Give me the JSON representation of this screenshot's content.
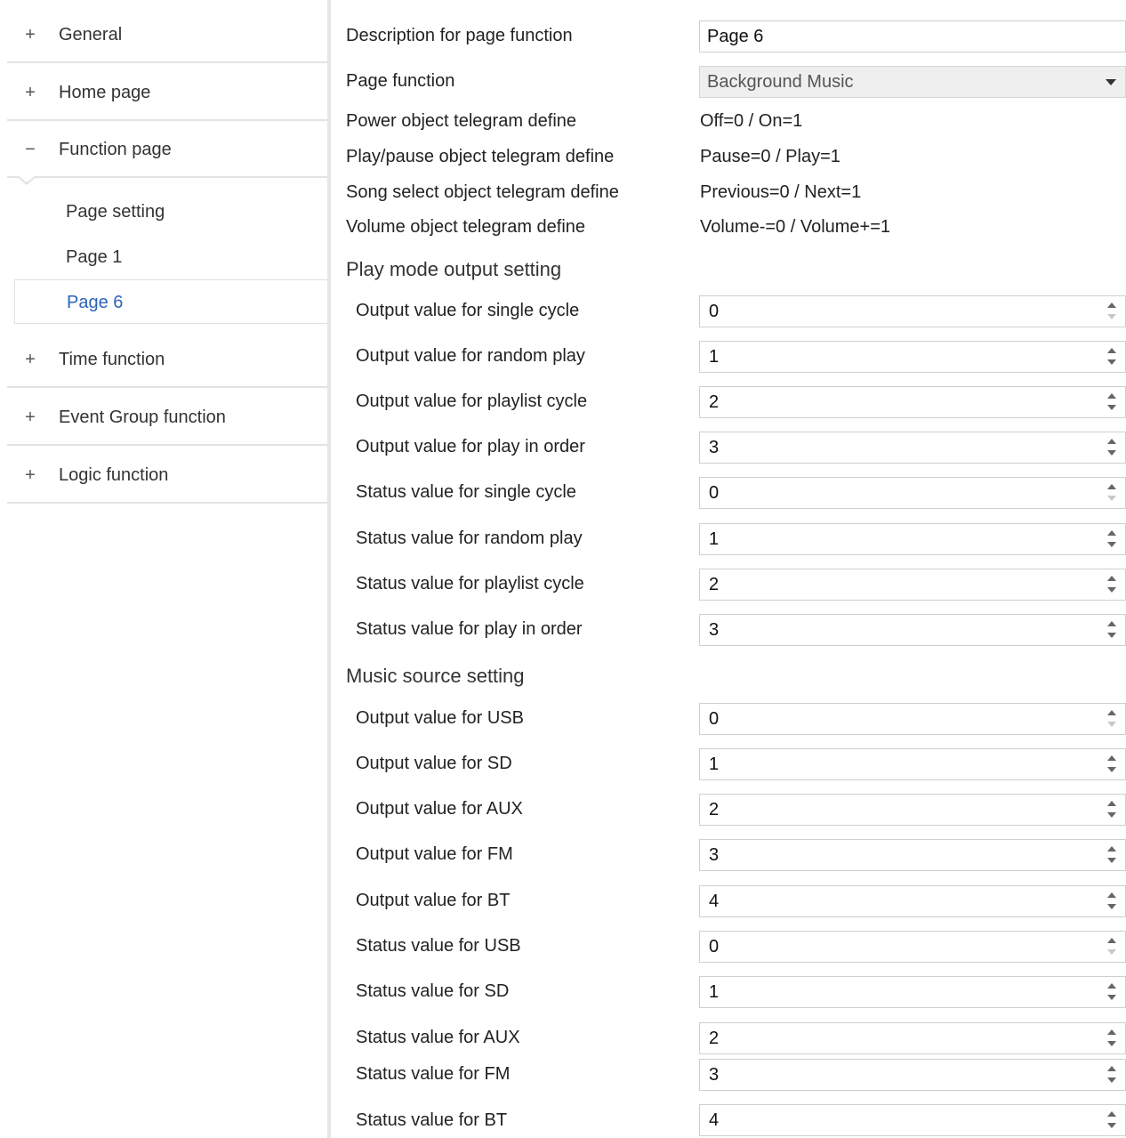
{
  "sidebar": {
    "items": [
      {
        "sign": "+",
        "label": "General"
      },
      {
        "sign": "+",
        "label": "Home page"
      },
      {
        "sign": "−",
        "label": "Function page"
      },
      {
        "sign": "+",
        "label": "Time function"
      },
      {
        "sign": "+",
        "label": "Event Group function"
      },
      {
        "sign": "+",
        "label": "Logic function"
      }
    ],
    "subitems": [
      {
        "label": "Page setting"
      },
      {
        "label": "Page 1"
      },
      {
        "label": "Page 6",
        "active": true
      }
    ],
    "active_color": "#2c64b8"
  },
  "main": {
    "description_label": "Description for page function",
    "description_value": "Page 6",
    "page_function_label": "Page function",
    "page_function_value": "Background Music",
    "info": [
      {
        "label": "Power object telegram define",
        "value": "Off=0 / On=1"
      },
      {
        "label": "Play/pause object telegram define",
        "value": "Pause=0 / Play=1"
      },
      {
        "label": "Song select object telegram define",
        "value": "Previous=0 / Next=1"
      },
      {
        "label": "Volume object telegram define",
        "value": "Volume-=0 / Volume+=1"
      }
    ],
    "section_play_mode": "Play mode output setting",
    "play_mode": [
      {
        "label": "Output value for single cycle",
        "value": "0"
      },
      {
        "label": "Output value for random play",
        "value": "1"
      },
      {
        "label": "Output value for playlist cycle",
        "value": "2"
      },
      {
        "label": "Output value for play in order",
        "value": "3"
      },
      {
        "label": "Status value for single cycle",
        "value": "0"
      },
      {
        "label": "Status value for random play",
        "value": "1"
      },
      {
        "label": "Status value for playlist cycle",
        "value": "2"
      },
      {
        "label": "Status value for play in order",
        "value": "3"
      }
    ],
    "section_music_source": "Music source setting",
    "music_source": [
      {
        "label": "Output value for USB",
        "value": "0"
      },
      {
        "label": "Output value for SD",
        "value": "1"
      },
      {
        "label": "Output value for AUX",
        "value": "2"
      },
      {
        "label": "Output value for FM",
        "value": "3"
      },
      {
        "label": "Output value for BT",
        "value": "4"
      },
      {
        "label": "Status value for USB",
        "value": "0"
      },
      {
        "label": "Status value for SD",
        "value": "1"
      },
      {
        "label": "Status value for AUX",
        "value": "2"
      },
      {
        "label": "Status value for FM",
        "value": "3"
      },
      {
        "label": "Status value for BT",
        "value": "4"
      }
    ]
  }
}
